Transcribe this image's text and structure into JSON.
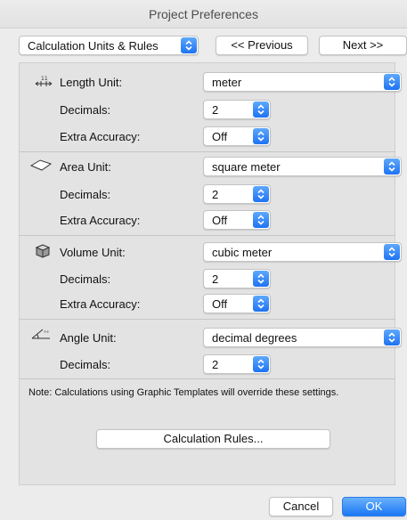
{
  "window": {
    "title": "Project Preferences"
  },
  "nav": {
    "category": "Calculation Units & Rules",
    "previous_label": "<< Previous",
    "next_label": "Next >>"
  },
  "length": {
    "label": "Length Unit:",
    "unit": "meter",
    "decimals_label": "Decimals:",
    "decimals": "2",
    "accuracy_label": "Extra Accuracy:",
    "accuracy": "Off",
    "icon": "ruler-icon"
  },
  "area": {
    "label": "Area Unit:",
    "unit": "square meter",
    "decimals_label": "Decimals:",
    "decimals": "2",
    "accuracy_label": "Extra Accuracy:",
    "accuracy": "Off",
    "icon": "area-icon"
  },
  "volume": {
    "label": "Volume Unit:",
    "unit": "cubic meter",
    "decimals_label": "Decimals:",
    "decimals": "2",
    "accuracy_label": "Extra Accuracy:",
    "accuracy": "Off",
    "icon": "cube-icon"
  },
  "angle": {
    "label": "Angle Unit:",
    "unit": "decimal degrees",
    "decimals_label": "Decimals:",
    "decimals": "2",
    "icon": "angle-icon"
  },
  "note": "Note: Calculations using Graphic Templates will override these settings.",
  "rules_button": "Calculation Rules...",
  "footer": {
    "cancel_label": "Cancel",
    "ok_label": "OK"
  },
  "colors": {
    "accent": "#1e73f3",
    "panel": "#e3e3e3",
    "window": "#ececec"
  }
}
